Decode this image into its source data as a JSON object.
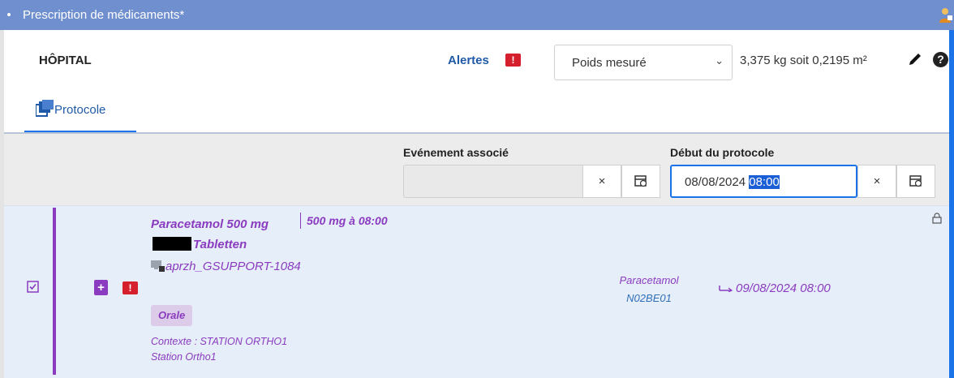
{
  "window": {
    "title": "Prescription de médicaments*"
  },
  "header": {
    "hospital": "HÔPITAL",
    "alerts_label": "Alertes",
    "weight_select_value": "Poids mesuré",
    "weight_text": "3,375 kg soit 0,2195 m²",
    "help_symbol": "?"
  },
  "tabs": [
    {
      "label": "Protocole"
    }
  ],
  "filters": {
    "event_label": "Evénement associé",
    "event_value": "",
    "start_label": "Début du protocole",
    "start_date": "08/08/2024 ",
    "start_time_selected": "08:00",
    "clear_symbol": "×"
  },
  "prescription": {
    "drug_name_part1": "Paracetamol 500 mg",
    "drug_name_part2": "Tabletten",
    "dose": "500 mg à 08:00",
    "support_id": "aprzh_GSUPPORT-1084",
    "route": "Orale",
    "context": "Contexte : STATION ORTHO1 Station Ortho1",
    "molecule": "Paracetamol",
    "atc_code": "N02BE01",
    "end_date": "09/08/2024 08:00",
    "alert_symbol": "!",
    "add_symbol": "+"
  },
  "colors": {
    "titlebar": "#6f8fce",
    "accent_blue": "#1a73e8",
    "drug_purple": "#8a3bbf",
    "alert_red": "#d61f2c",
    "row_bg": "#e6eef9",
    "filter_bg": "#ececec"
  },
  "icons": [
    "user-alert-icon",
    "pencil-icon",
    "help-icon",
    "protocol-icon",
    "clear-icon",
    "calendar-icon",
    "checkbox-icon",
    "add-document-icon",
    "alert-icon",
    "workstation-lock-icon",
    "arrow-right-icon",
    "lock-icon"
  ]
}
